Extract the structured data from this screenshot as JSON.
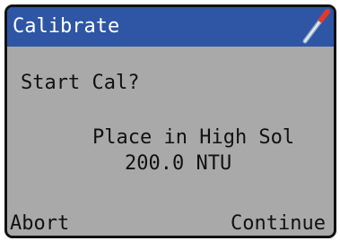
{
  "window": {
    "title": "Calibrate",
    "icon": "probe-icon"
  },
  "content": {
    "prompt": "Start Cal?",
    "instruction": "Place in High Sol",
    "standard_value": "200.0 NTU"
  },
  "softkeys": {
    "left_label": "Abort",
    "right_label": "Continue"
  },
  "colors": {
    "titlebar": "#2f56a4",
    "background": "#a9a9a9",
    "text": "#111111",
    "title_text": "#ffffff",
    "icon_tip": "#e03a2c"
  }
}
